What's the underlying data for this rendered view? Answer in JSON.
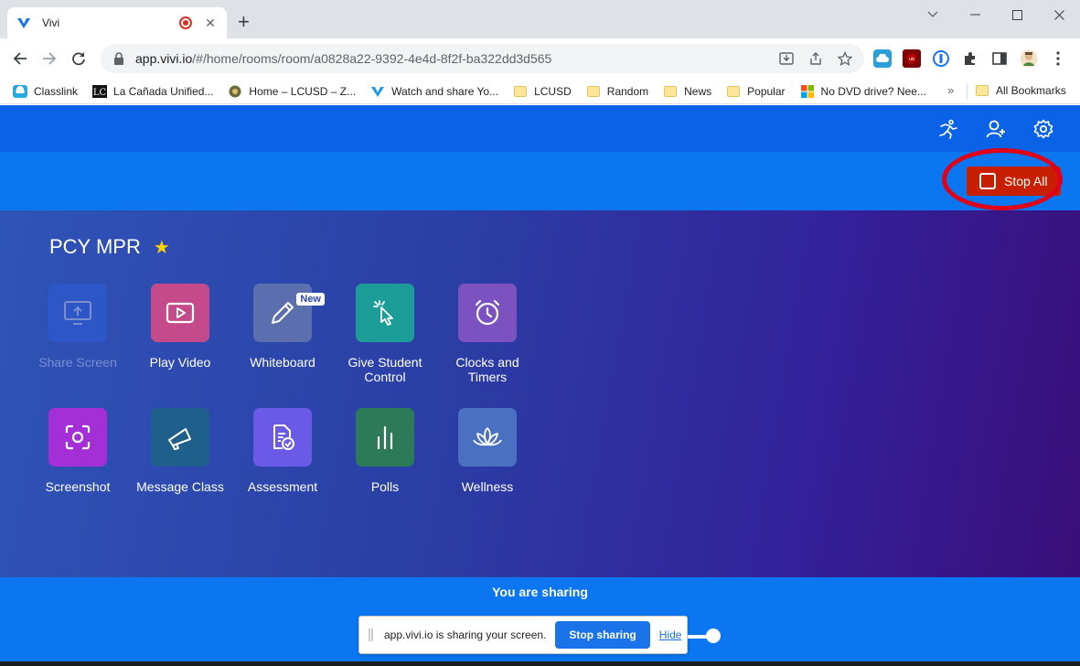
{
  "browser": {
    "tab_title": "Vivi",
    "tab_close": "✕",
    "new_tab": "+",
    "url_host": "app.vivi.io",
    "url_path": "/#/home/rooms/room/a0828a22-9392-4e4d-8f2f-ba322dd3d565",
    "bookmarks": [
      {
        "label": "Classlink",
        "icon": "classlink-icon"
      },
      {
        "label": "La Cañada Unified...",
        "icon": "lc-icon"
      },
      {
        "label": "Home – LCUSD – Z...",
        "icon": "lcusd-icon"
      },
      {
        "label": "Watch and share Yo...",
        "icon": "vivi-icon"
      },
      {
        "label": "LCUSD",
        "icon": "folder-icon"
      },
      {
        "label": "Random",
        "icon": "folder-icon"
      },
      {
        "label": "News",
        "icon": "folder-icon"
      },
      {
        "label": "Popular",
        "icon": "folder-icon"
      },
      {
        "label": "No DVD drive? Nee...",
        "icon": "microsoft-icon"
      }
    ],
    "bookmarks_more": "»",
    "all_bookmarks": "All Bookmarks"
  },
  "app": {
    "stop_all_label": "Stop All",
    "room_title": "PCY MPR",
    "star": "★",
    "tiles": [
      {
        "label": "Share Screen",
        "icon": "share-screen-icon",
        "color": "#2d57c6"
      },
      {
        "label": "Play Video",
        "icon": "play-video-icon",
        "color": "#c54a8c"
      },
      {
        "label": "Whiteboard",
        "icon": "whiteboard-pen-icon",
        "color": "#5b6fae",
        "badge": "New"
      },
      {
        "label": "Give Student Control",
        "icon": "pointer-click-icon",
        "color": "#1d9d97"
      },
      {
        "label": "Clocks and Timers",
        "icon": "alarm-clock-icon",
        "color": "#7b52c0"
      },
      {
        "label": "Screenshot",
        "icon": "screenshot-icon",
        "color": "#a42fd6"
      },
      {
        "label": "Message Class",
        "icon": "megaphone-icon",
        "color": "#1f5f8c"
      },
      {
        "label": "Assessment",
        "icon": "assessment-doc-icon",
        "color": "#6b5ae8"
      },
      {
        "label": "Polls",
        "icon": "poll-bars-icon",
        "color": "#2c7a57"
      },
      {
        "label": "Wellness",
        "icon": "lotus-icon",
        "color": "#4a70c2"
      }
    ],
    "sharing_label": "You are sharing"
  },
  "share_popup": {
    "message": "app.vivi.io is sharing your screen.",
    "stop_label": "Stop sharing",
    "hide_label": "Hide"
  },
  "colors": {
    "header": "#0a63e6",
    "stop_bar": "#0b76ef",
    "stop_button": "#c81f00",
    "highlight_ellipse": "#e00017"
  }
}
